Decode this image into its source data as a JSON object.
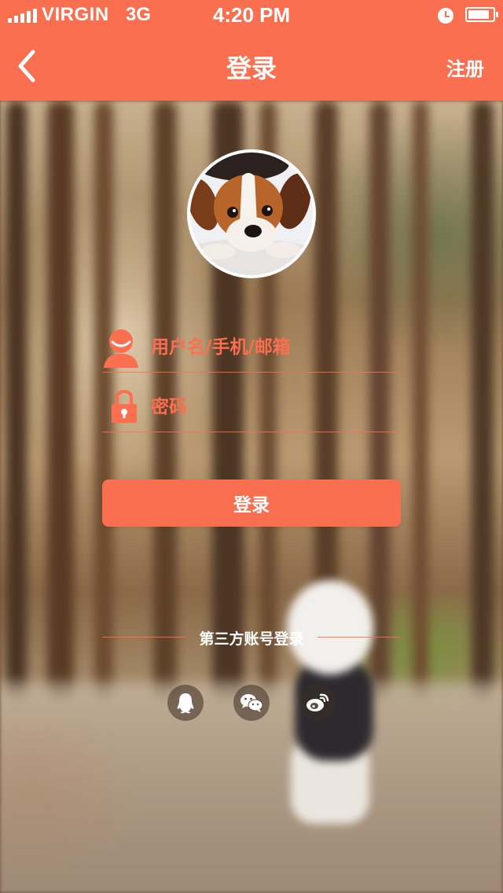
{
  "status_bar": {
    "carrier": "VIRGIN",
    "network": "3G",
    "time": "4:20 PM",
    "alarm_icon": "alarm-clock-icon",
    "battery_icon": "battery-icon",
    "battery_level": 0.85
  },
  "nav": {
    "back_icon": "chevron-left-icon",
    "title": "登录",
    "register_label": "注册"
  },
  "avatar": {
    "icon": "avatar-photo"
  },
  "form": {
    "username": {
      "placeholder": "用户名/手机/邮箱",
      "value": "",
      "icon": "user-icon"
    },
    "password": {
      "placeholder": "密码",
      "value": "",
      "icon": "lock-icon"
    },
    "login_button_label": "登录"
  },
  "third_party": {
    "label": "第三方账号登录",
    "providers": [
      {
        "name": "QQ",
        "icon": "qq-icon"
      },
      {
        "name": "WeChat",
        "icon": "wechat-icon"
      },
      {
        "name": "Weibo",
        "icon": "weibo-icon"
      }
    ]
  },
  "colors": {
    "accent": "#fa6f4f",
    "text_on_accent": "#ffffff"
  }
}
